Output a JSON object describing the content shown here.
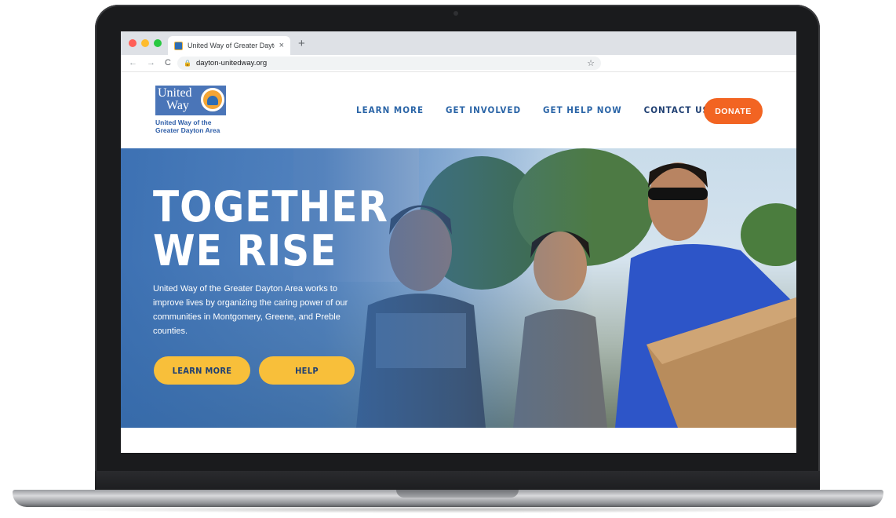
{
  "browser": {
    "tab_title": "United Way of Greater Dayton",
    "tab_close": "×",
    "new_tab": "+",
    "url": "dayton-unitedway.org",
    "nav_back": "←",
    "nav_forward": "→",
    "nav_reload": "C",
    "lock": "🔒",
    "star": "☆"
  },
  "logo": {
    "line1": "United",
    "line2": "Way",
    "sub1": "United Way of the",
    "sub2": "Greater Dayton Area"
  },
  "nav": {
    "items": [
      "LEARN MORE",
      "GET INVOLVED",
      "GET HELP NOW",
      "CONTACT US"
    ],
    "donate": "DONATE"
  },
  "hero": {
    "title_line1": "TOGETHER",
    "title_line2": "WE RISE",
    "body": "United Way of the Greater Dayton Area works to improve lives by organizing the caring power of our communities in Montgomery, Greene, and Preble counties.",
    "btn_learn": "LEARN MORE",
    "btn_help": "HELP"
  },
  "colors": {
    "brand_blue": "#2b65a7",
    "donate_orange": "#f26422",
    "button_yellow": "#f8bf3a"
  }
}
